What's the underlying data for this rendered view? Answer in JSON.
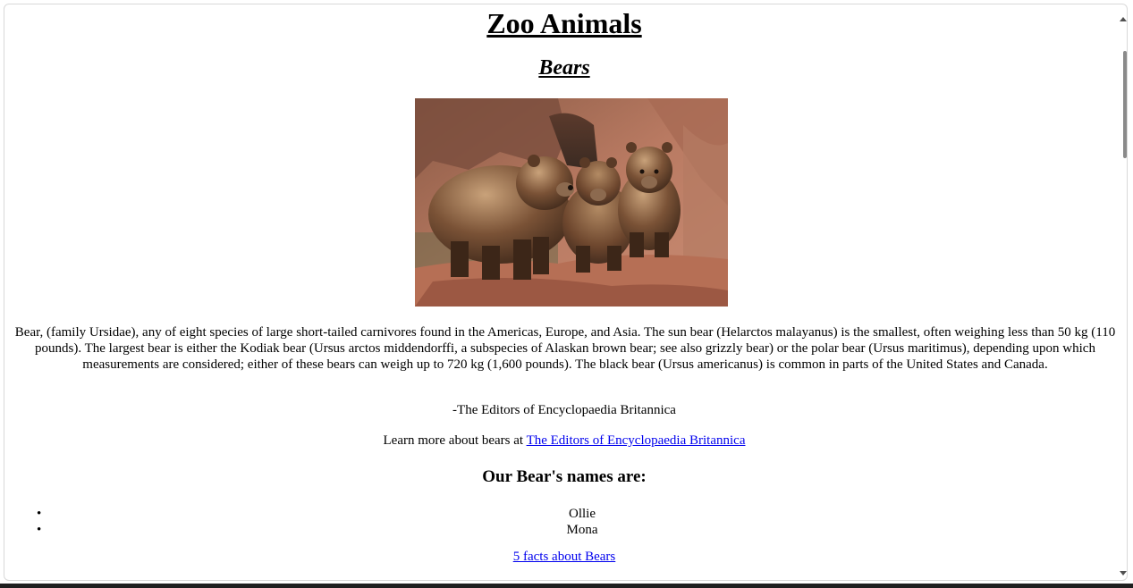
{
  "page": {
    "title": "Zoo Animals",
    "subtitle": "Bears",
    "image_alt": "Three brown bears standing on rocks",
    "description": "Bear, (family Ursidae), any of eight species of large short-tailed carnivores found in the Americas, Europe, and Asia. The sun bear (Helarctos malayanus) is the smallest, often weighing less than 50 kg (110 pounds). The largest bear is either the Kodiak bear (Ursus arctos middendorffi, a subspecies of Alaskan brown bear; see also grizzly bear) or the polar bear (Ursus maritimus), depending upon which measurements are considered; either of these bears can weigh up to 720 kg (1,600 pounds). The black bear (Ursus americanus) is common in parts of the United States and Canada.",
    "credit": "-The Editors of Encyclopaedia Britannica",
    "learn_more_prefix": "Learn more about bears at ",
    "learn_more_link": "The Editors of Encyclopaedia Britannica",
    "names_heading": "Our Bear's names are:",
    "names": [
      "Ollie",
      "Mona"
    ],
    "bullet": "•",
    "facts_link": "5 facts about Bears"
  },
  "colors": {
    "link": "#0000ee",
    "background": "#ffffff",
    "text": "#000000"
  },
  "icons": {
    "scroll_up": "triangle-up-icon",
    "scroll_down": "triangle-down-icon"
  }
}
